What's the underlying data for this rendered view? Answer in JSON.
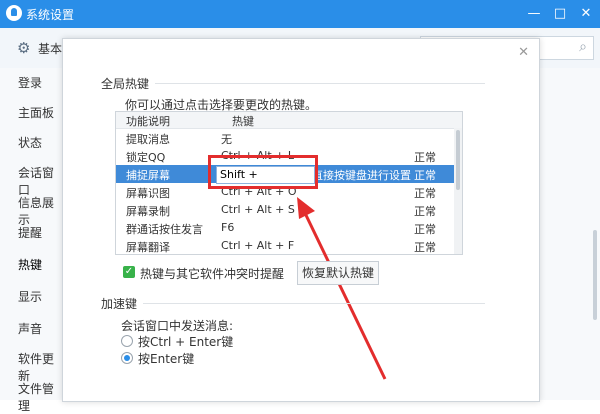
{
  "window": {
    "title": "系统设置",
    "buttons": [
      "minimize",
      "maximize",
      "close"
    ]
  },
  "header": {
    "section": "基本"
  },
  "sidebar": {
    "items": [
      {
        "label": "登录"
      },
      {
        "label": "主面板"
      },
      {
        "label": "状态"
      },
      {
        "label": "会话窗口"
      },
      {
        "label": "信息展示"
      },
      {
        "label": "提醒"
      },
      {
        "label": "热键",
        "active": true
      },
      {
        "label": "显示"
      },
      {
        "label": "声音"
      },
      {
        "label": "软件更新"
      },
      {
        "label": "文件管理"
      }
    ]
  },
  "dialog": {
    "global_hotkeys_title": "全局热键",
    "hint": "你可以通过点击选择要更改的热键。",
    "table": {
      "columns": [
        "功能说明",
        "热键"
      ],
      "rows": [
        {
          "func": "提取消息",
          "key": "无",
          "status": ""
        },
        {
          "func": "锁定QQ",
          "key": "Ctrl + Alt + L",
          "status": "正常"
        },
        {
          "func": "捕捉屏幕",
          "key": "Shift +",
          "hint": "直接按键盘进行设置",
          "status": "正常",
          "selected": true
        },
        {
          "func": "屏幕识图",
          "key": "Ctrl + Alt + O",
          "status": "正常"
        },
        {
          "func": "屏幕录制",
          "key": "Ctrl + Alt + S",
          "status": "正常"
        },
        {
          "func": "群通话按住发言",
          "key": "F6",
          "status": "正常"
        },
        {
          "func": "屏幕翻译",
          "key": "Ctrl + Alt + F",
          "status": "正常"
        }
      ]
    },
    "conflict_checkbox": {
      "label": "热键与其它软件冲突时提醒",
      "checked": true
    },
    "restore_button": "恢复默认热键",
    "accel_title": "加速键",
    "send_message_label": "会话窗口中发送消息:",
    "radio_options": [
      {
        "label": "按Ctrl + Enter键",
        "checked": false
      },
      {
        "label": "按Enter键",
        "checked": true
      }
    ]
  },
  "colors": {
    "titlebar": "#2a8ee8",
    "selection": "#3f8ad8",
    "annotation": "#e32d2d",
    "checkbox": "#38b24a"
  }
}
